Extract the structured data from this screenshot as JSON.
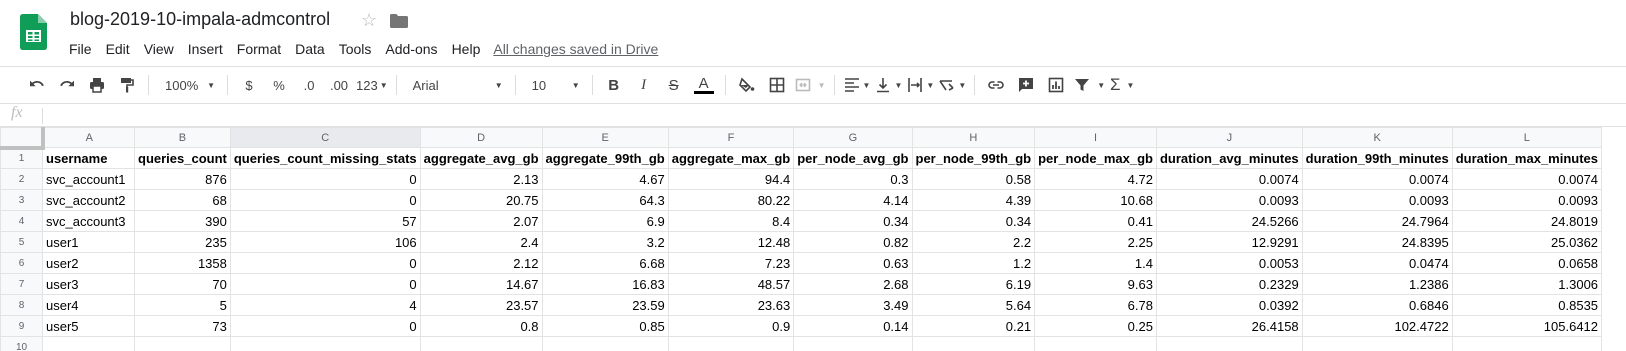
{
  "doc": {
    "title": "blog-2019-10-impala-admcontrol",
    "saved_status": "All changes saved in Drive"
  },
  "menu": [
    "File",
    "Edit",
    "View",
    "Insert",
    "Format",
    "Data",
    "Tools",
    "Add-ons",
    "Help"
  ],
  "toolbar": {
    "zoom": "100%",
    "currency": "$",
    "percent": "%",
    "decrease_decimals": ".0",
    "increase_decimals": ".00",
    "more_formats": "123",
    "font": "Arial",
    "font_size": "10",
    "bold": "B",
    "italic": "I",
    "strikethrough": "S",
    "text_color_glyph": "A",
    "sum_glyph": "Σ"
  },
  "formula_bar": {
    "fx_label": "fx",
    "value": ""
  },
  "sheet": {
    "column_letters": [
      "A",
      "B",
      "C",
      "D",
      "E",
      "F",
      "G",
      "H",
      "I",
      "J",
      "K",
      "L"
    ],
    "row_numbers": [
      "1",
      "2",
      "3",
      "4",
      "5",
      "6",
      "7",
      "8",
      "9",
      "10"
    ],
    "header": [
      "username",
      "queries_count",
      "queries_count_missing_stats",
      "aggregate_avg_gb",
      "aggregate_99th_gb",
      "aggregate_max_gb",
      "per_node_avg_gb",
      "per_node_99th_gb",
      "per_node_max_gb",
      "duration_avg_minutes",
      "duration_99th_minutes",
      "duration_max_minutes"
    ],
    "rows": [
      [
        "svc_account1",
        "876",
        "0",
        "2.13",
        "4.67",
        "94.4",
        "0.3",
        "0.58",
        "4.72",
        "0.0074",
        "0.0074",
        "0.0074"
      ],
      [
        "svc_account2",
        "68",
        "0",
        "20.75",
        "64.3",
        "80.22",
        "4.14",
        "4.39",
        "10.68",
        "0.0093",
        "0.0093",
        "0.0093"
      ],
      [
        "svc_account3",
        "390",
        "57",
        "2.07",
        "6.9",
        "8.4",
        "0.34",
        "0.34",
        "0.41",
        "24.5266",
        "24.7964",
        "24.8019"
      ],
      [
        "user1",
        "235",
        "106",
        "2.4",
        "3.2",
        "12.48",
        "0.82",
        "2.2",
        "2.25",
        "12.9291",
        "24.8395",
        "25.0362"
      ],
      [
        "user2",
        "1358",
        "0",
        "2.12",
        "6.68",
        "7.23",
        "0.63",
        "1.2",
        "1.4",
        "0.0053",
        "0.0474",
        "0.0658"
      ],
      [
        "user3",
        "70",
        "0",
        "14.67",
        "16.83",
        "48.57",
        "2.68",
        "6.19",
        "9.63",
        "0.2329",
        "1.2386",
        "1.3006"
      ],
      [
        "user4",
        "5",
        "4",
        "23.57",
        "23.59",
        "23.63",
        "3.49",
        "5.64",
        "6.78",
        "0.0392",
        "0.6846",
        "0.8535"
      ],
      [
        "user5",
        "73",
        "0",
        "0.8",
        "0.85",
        "0.9",
        "0.14",
        "0.21",
        "0.25",
        "26.4158",
        "102.4722",
        "105.6412"
      ]
    ]
  }
}
